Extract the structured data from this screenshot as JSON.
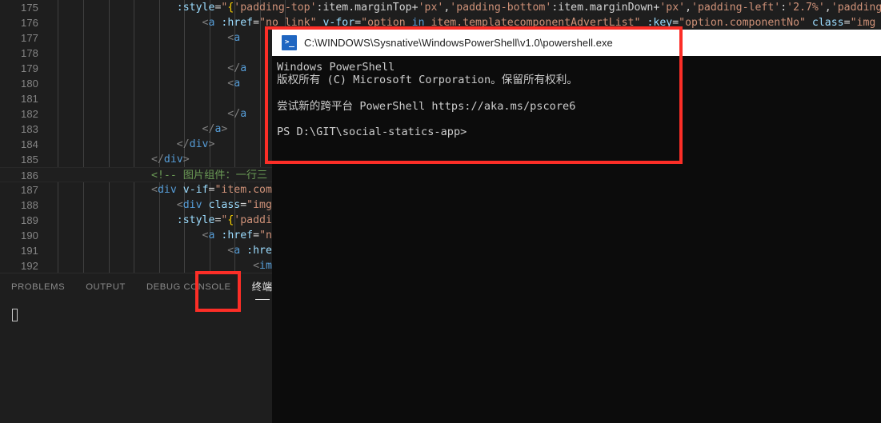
{
  "editor": {
    "language": "vue-html",
    "first_line": 175,
    "lines": [
      {
        "number": "175",
        "tokens": [
          {
            "t": "attr",
            "v": "                    :style"
          },
          {
            "t": "plain",
            "v": "="
          },
          {
            "t": "str",
            "v": "\""
          },
          {
            "t": "brace",
            "v": "{"
          },
          {
            "t": "str",
            "v": "'padding-top'"
          },
          {
            "t": "plain",
            "v": ":"
          },
          {
            "t": "plain",
            "v": "item.marginTop+"
          },
          {
            "t": "str",
            "v": "'px'"
          },
          {
            "t": "plain",
            "v": ","
          },
          {
            "t": "str",
            "v": "'padding-bottom'"
          },
          {
            "t": "plain",
            "v": ":"
          },
          {
            "t": "plain",
            "v": "item.marginDown+"
          },
          {
            "t": "str",
            "v": "'px'"
          },
          {
            "t": "plain",
            "v": ","
          },
          {
            "t": "str",
            "v": "'padding-left'"
          },
          {
            "t": "plain",
            "v": ":"
          },
          {
            "t": "str",
            "v": "'2.7%'"
          },
          {
            "t": "plain",
            "v": ","
          },
          {
            "t": "str",
            "v": "'padding-ri"
          }
        ]
      },
      {
        "number": "176",
        "tokens": [
          {
            "t": "punct",
            "v": "                        <"
          },
          {
            "t": "tag",
            "v": "a"
          },
          {
            "t": "plain",
            "v": " "
          },
          {
            "t": "attr",
            "v": ":href"
          },
          {
            "t": "plain",
            "v": "="
          },
          {
            "t": "str",
            "v": "\"no_link\""
          },
          {
            "t": "plain",
            "v": " "
          },
          {
            "t": "attr",
            "v": "v-for"
          },
          {
            "t": "plain",
            "v": "="
          },
          {
            "t": "str",
            "v": "\"option"
          },
          {
            "t": "kw",
            "v": " in "
          },
          {
            "t": "str",
            "v": "item.templatecomponentAdvertList\""
          },
          {
            "t": "plain",
            "v": " "
          },
          {
            "t": "attr",
            "v": ":key"
          },
          {
            "t": "plain",
            "v": "="
          },
          {
            "t": "str",
            "v": "\"option.componentNo\""
          },
          {
            "t": "plain",
            "v": " "
          },
          {
            "t": "attr",
            "v": "class"
          },
          {
            "t": "plain",
            "v": "="
          },
          {
            "t": "str",
            "v": "\"img"
          }
        ]
      },
      {
        "number": "177",
        "tokens": [
          {
            "t": "punct",
            "v": "                            <"
          },
          {
            "t": "tag",
            "v": "a"
          }
        ]
      },
      {
        "number": "178",
        "tokens": []
      },
      {
        "number": "179",
        "tokens": [
          {
            "t": "punct",
            "v": "                            </"
          },
          {
            "t": "tag",
            "v": "a"
          }
        ]
      },
      {
        "number": "180",
        "tokens": [
          {
            "t": "punct",
            "v": "                            <"
          },
          {
            "t": "tag",
            "v": "a"
          }
        ]
      },
      {
        "number": "181",
        "tokens": []
      },
      {
        "number": "182",
        "tokens": [
          {
            "t": "punct",
            "v": "                            </"
          },
          {
            "t": "tag",
            "v": "a"
          }
        ]
      },
      {
        "number": "183",
        "tokens": [
          {
            "t": "punct",
            "v": "                        </"
          },
          {
            "t": "tag",
            "v": "a"
          },
          {
            "t": "punct",
            "v": ">"
          }
        ]
      },
      {
        "number": "184",
        "tokens": [
          {
            "t": "punct",
            "v": "                    </"
          },
          {
            "t": "tag",
            "v": "div"
          },
          {
            "t": "punct",
            "v": ">"
          }
        ]
      },
      {
        "number": "185",
        "tokens": [
          {
            "t": "punct",
            "v": "                </"
          },
          {
            "t": "tag",
            "v": "div"
          },
          {
            "t": "punct",
            "v": ">"
          }
        ]
      },
      {
        "number": "186",
        "current": true,
        "tokens": [
          {
            "t": "comment",
            "v": "                <!-- 图片组件：一行三"
          }
        ]
      },
      {
        "number": "187",
        "tokens": [
          {
            "t": "punct",
            "v": "                <"
          },
          {
            "t": "tag",
            "v": "div"
          },
          {
            "t": "plain",
            "v": " "
          },
          {
            "t": "attr",
            "v": "v-if"
          },
          {
            "t": "plain",
            "v": "="
          },
          {
            "t": "str",
            "v": "\"item.com"
          }
        ]
      },
      {
        "number": "188",
        "tokens": [
          {
            "t": "punct",
            "v": "                    <"
          },
          {
            "t": "tag",
            "v": "div"
          },
          {
            "t": "plain",
            "v": " "
          },
          {
            "t": "attr",
            "v": "class"
          },
          {
            "t": "plain",
            "v": "="
          },
          {
            "t": "str",
            "v": "\"img"
          }
        ]
      },
      {
        "number": "189",
        "tokens": [
          {
            "t": "attr",
            "v": "                    :style"
          },
          {
            "t": "plain",
            "v": "="
          },
          {
            "t": "str",
            "v": "\""
          },
          {
            "t": "brace",
            "v": "{"
          },
          {
            "t": "str",
            "v": "'paddi"
          }
        ]
      },
      {
        "number": "190",
        "tokens": [
          {
            "t": "punct",
            "v": "                        <"
          },
          {
            "t": "tag",
            "v": "a"
          },
          {
            "t": "plain",
            "v": " "
          },
          {
            "t": "attr",
            "v": ":href"
          },
          {
            "t": "plain",
            "v": "="
          },
          {
            "t": "str",
            "v": "\"n"
          }
        ]
      },
      {
        "number": "191",
        "tokens": [
          {
            "t": "punct",
            "v": "                            <"
          },
          {
            "t": "tag",
            "v": "a"
          },
          {
            "t": "plain",
            "v": " "
          },
          {
            "t": "attr",
            "v": ":hre"
          }
        ]
      },
      {
        "number": "192",
        "tokens": [
          {
            "t": "punct",
            "v": "                                <"
          },
          {
            "t": "tag",
            "v": "im"
          }
        ]
      }
    ]
  },
  "panel": {
    "tabs": [
      {
        "label": "PROBLEMS",
        "active": false,
        "cjk": false
      },
      {
        "label": "OUTPUT",
        "active": false,
        "cjk": false
      },
      {
        "label": "DEBUG CONSOLE",
        "active": false,
        "cjk": false
      },
      {
        "label": "终端",
        "active": true,
        "cjk": true
      }
    ]
  },
  "powershell": {
    "icon": "powershell-icon",
    "title": "C:\\WINDOWS\\Sysnative\\WindowsPowerShell\\v1.0\\powershell.exe",
    "lines": [
      "Windows PowerShell",
      "版权所有 (C) Microsoft Corporation。保留所有权利。",
      "",
      "尝试新的跨平台 PowerShell https://aka.ms/pscore6",
      "",
      "PS D:\\GIT\\social-statics-app>"
    ]
  },
  "annotations": {
    "color": "#fc2e27",
    "boxes": [
      {
        "name": "terminal-window-highlight"
      },
      {
        "name": "terminal-tab-highlight"
      }
    ]
  }
}
